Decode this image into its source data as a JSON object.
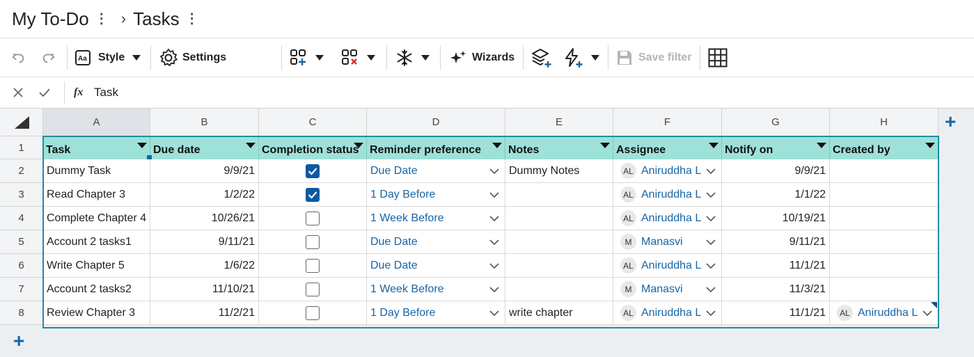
{
  "breadcrumb": {
    "workspace": "My To-Do",
    "sheet": "Tasks"
  },
  "toolbar": {
    "style_label": "Style",
    "settings_label": "Settings",
    "wizards_label": "Wizards",
    "save_filter_label": "Save filter"
  },
  "formula_bar": {
    "fx": "fx",
    "value": "Task"
  },
  "columns": [
    "A",
    "B",
    "C",
    "D",
    "E",
    "F",
    "G",
    "H"
  ],
  "headers": [
    "Task",
    "Due date",
    "Completion status",
    "Reminder preference",
    "Notes",
    "Assignee",
    "Notify on",
    "Created by"
  ],
  "row_numbers": [
    "1",
    "2",
    "3",
    "4",
    "5",
    "6",
    "7",
    "8"
  ],
  "rows": [
    {
      "task": "Dummy Task",
      "due": "9/9/21",
      "done": true,
      "reminder": "Due Date",
      "notes": "Dummy Notes",
      "assignee_initials": "AL",
      "assignee": "Aniruddha L",
      "notify": "9/9/21",
      "created_initials": "",
      "created": ""
    },
    {
      "task": "Read Chapter 3",
      "due": "1/2/22",
      "done": true,
      "reminder": "1 Day Before",
      "notes": "",
      "assignee_initials": "AL",
      "assignee": "Aniruddha L",
      "notify": "1/1/22",
      "created_initials": "",
      "created": ""
    },
    {
      "task": "Complete Chapter 4",
      "due": "10/26/21",
      "done": false,
      "reminder": "1 Week Before",
      "notes": "",
      "assignee_initials": "AL",
      "assignee": "Aniruddha L",
      "notify": "10/19/21",
      "created_initials": "",
      "created": ""
    },
    {
      "task": "Account 2 tasks1",
      "due": "9/11/21",
      "done": false,
      "reminder": "Due Date",
      "notes": "",
      "assignee_initials": "M",
      "assignee": "Manasvi",
      "notify": "9/11/21",
      "created_initials": "",
      "created": ""
    },
    {
      "task": "Write Chapter 5",
      "due": "1/6/22",
      "done": false,
      "reminder": "Due Date",
      "notes": "",
      "assignee_initials": "AL",
      "assignee": "Aniruddha L",
      "notify": "11/1/21",
      "created_initials": "",
      "created": ""
    },
    {
      "task": "Account 2 tasks2",
      "due": "11/10/21",
      "done": false,
      "reminder": "1 Week Before",
      "notes": "",
      "assignee_initials": "M",
      "assignee": "Manasvi",
      "notify": "11/3/21",
      "created_initials": "",
      "created": ""
    },
    {
      "task": "Review Chapter 3",
      "due": "11/2/21",
      "done": false,
      "reminder": "1 Day Before",
      "notes": "write chapter",
      "assignee_initials": "AL",
      "assignee": "Aniruddha L",
      "notify": "11/1/21",
      "created_initials": "AL",
      "created": "Aniruddha L"
    }
  ],
  "colors": {
    "header_fill": "#9ee1d8",
    "selection_border": "#1e8ea0",
    "link": "#1565a6",
    "checkbox_on": "#0c5aa0"
  }
}
